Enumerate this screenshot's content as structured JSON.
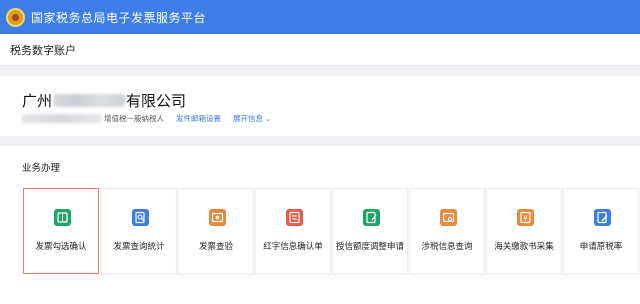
{
  "header": {
    "title": "国家税务总局电子发票服务平台"
  },
  "subheader": {
    "title": "税务数字账户"
  },
  "company": {
    "name_prefix": "广州",
    "name_suffix": "有限公司",
    "taxpayer_type": "增值税一般纳税人",
    "email_setting_link": "发件邮箱设置",
    "expand_info_link": "展开信息"
  },
  "business": {
    "title": "业务办理",
    "tiles": [
      {
        "label": "发票勾选确认",
        "icon": "invoice-check-icon",
        "color": "#1fa46a",
        "selected": true
      },
      {
        "label": "发票查询统计",
        "icon": "invoice-search-icon",
        "color": "#3c7ee6",
        "selected": false
      },
      {
        "label": "发票查验",
        "icon": "invoice-verify-icon",
        "color": "#e88a3c",
        "selected": false
      },
      {
        "label": "红字信息确认单",
        "icon": "red-letter-icon",
        "color": "#e85c4a",
        "selected": false
      },
      {
        "label": "授信额度调整申请",
        "icon": "credit-adjust-icon",
        "color": "#1fa46a",
        "selected": false
      },
      {
        "label": "涉税信息查询",
        "icon": "tax-info-icon",
        "color": "#e88a3c",
        "selected": false
      },
      {
        "label": "海关缴款书采集",
        "icon": "customs-payment-icon",
        "color": "#e88a3c",
        "selected": false
      },
      {
        "label": "申请原税率",
        "icon": "original-rate-icon",
        "color": "#3c7ee6",
        "selected": false
      }
    ]
  }
}
